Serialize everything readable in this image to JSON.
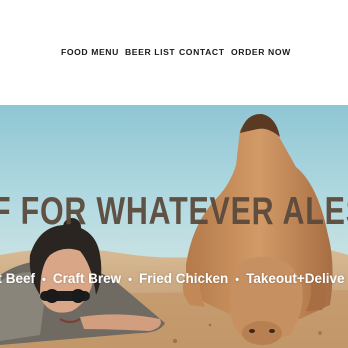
{
  "nav": {
    "items": [
      {
        "label": "FOOD MENU"
      },
      {
        "label": "BEER LIST"
      },
      {
        "label": "CONTACT"
      },
      {
        "label": "ORDER NOW"
      }
    ]
  },
  "hero": {
    "headline": "F FOR WHATEVER ALES",
    "ticker": {
      "items": [
        "st Beef",
        "Craft Brew",
        "Fried Chicken",
        "Takeout+Delive"
      ],
      "separator": "•"
    }
  },
  "colors": {
    "sky": "#a8d3dc",
    "sand": "#d6b58d",
    "headline": "#5b4a3c",
    "camel": "#c08a57"
  }
}
